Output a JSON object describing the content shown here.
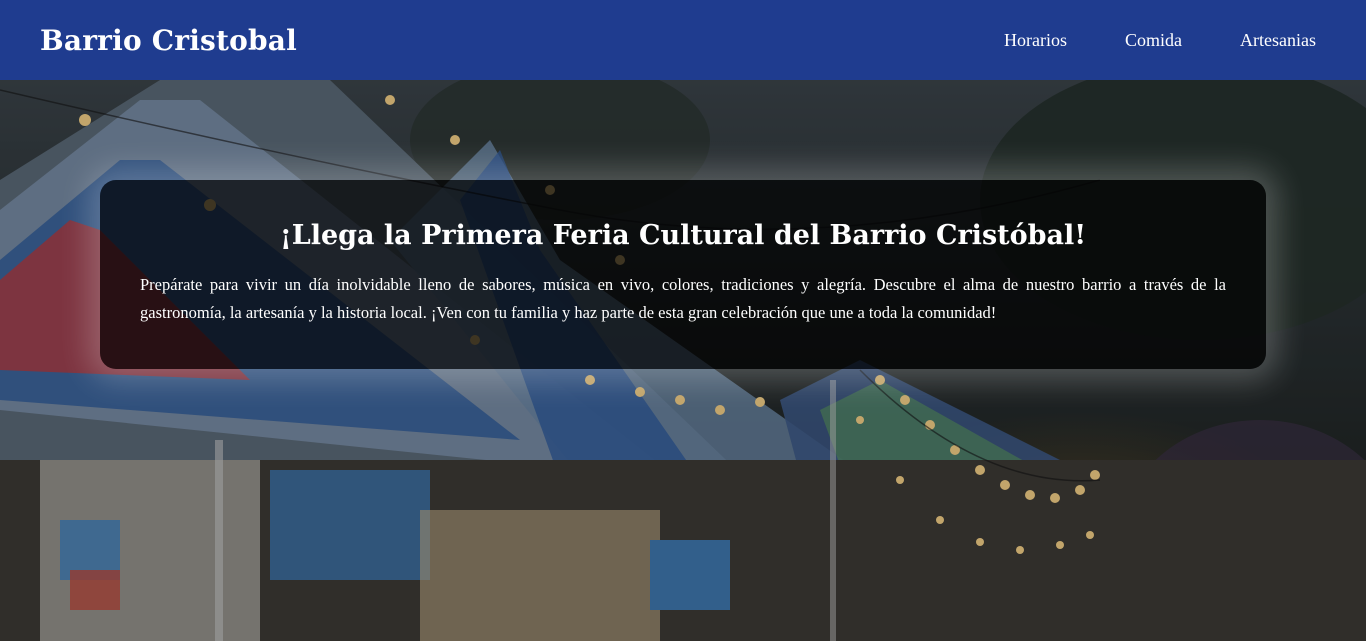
{
  "header": {
    "brand": "Barrio Cristobal",
    "nav": [
      "Horarios",
      "Comida",
      "Artesanias"
    ]
  },
  "hero": {
    "title": "¡Llega la Primera Feria Cultural del Barrio Cristóbal!",
    "text": "Prepárate para vivir un día inolvidable lleno de sabores, música en vivo, colores, tradiciones y alegría. Descubre el alma de nuestro barrio a través de la gastronomía, la artesanía y la historia local. ¡Ven con tu familia y haz parte de esta gran celebración que une a toda la comunidad!",
    "background_description": "fair-tents-string-lights-photo"
  },
  "colors": {
    "header_bg": "#1f3c8f",
    "text": "#ffffff",
    "card_bg": "rgba(0,0,0,0.68)"
  }
}
